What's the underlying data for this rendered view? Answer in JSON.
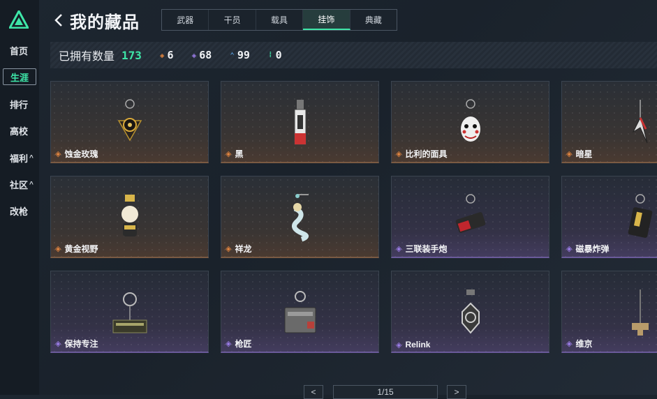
{
  "sidebar": {
    "items": [
      {
        "label": "首页",
        "active": false,
        "chevron": ""
      },
      {
        "label": "生涯",
        "active": true,
        "chevron": ""
      },
      {
        "label": "排行",
        "active": false,
        "chevron": ""
      },
      {
        "label": "高校",
        "active": false,
        "chevron": ""
      },
      {
        "label": "福利",
        "active": false,
        "chevron": "^"
      },
      {
        "label": "社区",
        "active": false,
        "chevron": "^"
      },
      {
        "label": "改枪",
        "active": false,
        "chevron": ""
      }
    ]
  },
  "header": {
    "title": "我的藏品",
    "tabs": [
      {
        "label": "武器",
        "active": false
      },
      {
        "label": "干员",
        "active": false
      },
      {
        "label": "载具",
        "active": false
      },
      {
        "label": "挂饰",
        "active": true
      },
      {
        "label": "典藏",
        "active": false
      }
    ]
  },
  "stats": {
    "owned_label": "已拥有数量",
    "owned_total": "173",
    "counts": [
      {
        "icon": "orange-diamond-icon",
        "color": "#e0843f",
        "value": "6"
      },
      {
        "icon": "purple-diamond-icon",
        "color": "#9b7de8",
        "value": "68"
      },
      {
        "icon": "blue-chevron-icon",
        "color": "#5aa0e0",
        "value": "99"
      },
      {
        "icon": "green-dots-icon",
        "color": "#3ee6a8",
        "value": "0"
      }
    ]
  },
  "items": [
    {
      "name": "蚀金玫瑰",
      "rarity": "orange"
    },
    {
      "name": "黑",
      "rarity": "orange"
    },
    {
      "name": "比利的面具",
      "rarity": "orange"
    },
    {
      "name": "暗星",
      "rarity": "orange"
    },
    {
      "name": "黄金视野",
      "rarity": "orange"
    },
    {
      "name": "祥龙",
      "rarity": "orange"
    },
    {
      "name": "三联装手炮",
      "rarity": "purple"
    },
    {
      "name": "磁暴炸弹",
      "rarity": "purple"
    },
    {
      "name": "保持专注",
      "rarity": "purple"
    },
    {
      "name": "枪匠",
      "rarity": "purple"
    },
    {
      "name": "Relink",
      "rarity": "purple"
    },
    {
      "name": "维京",
      "rarity": "purple"
    }
  ],
  "pager": {
    "indicator": "1/15",
    "prev": "<",
    "next": ">"
  },
  "colors": {
    "accent": "#3ee6a8",
    "orange": "#e0843f",
    "purple": "#9b7de8"
  }
}
